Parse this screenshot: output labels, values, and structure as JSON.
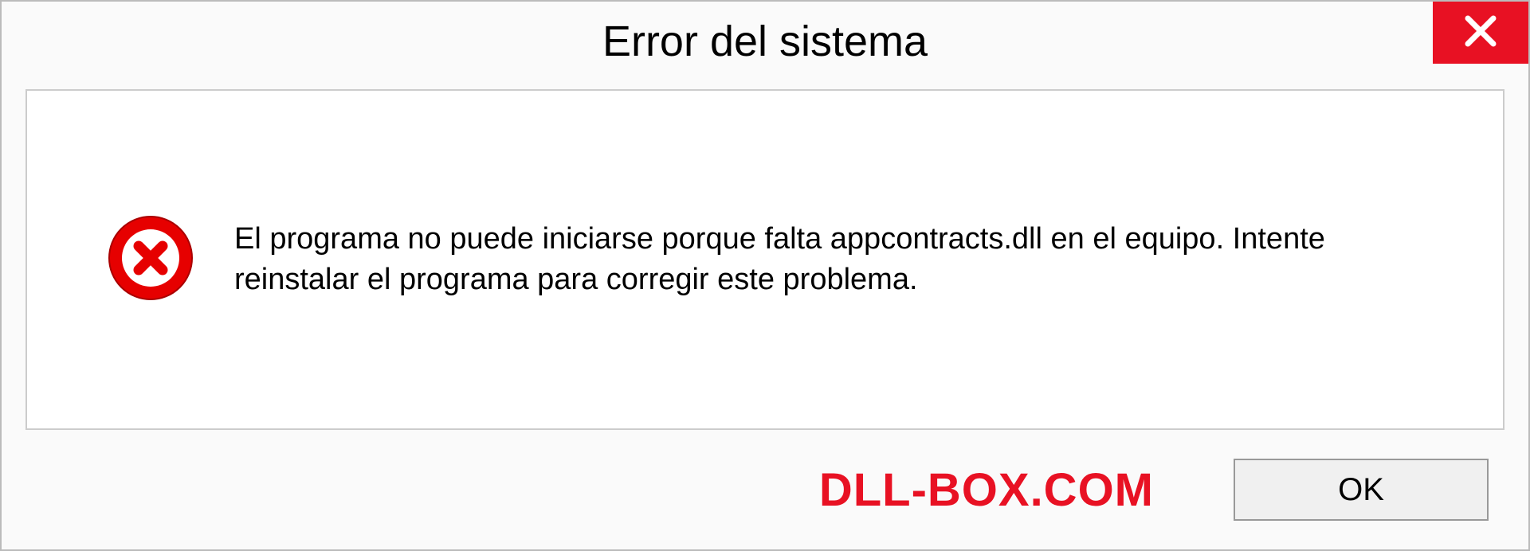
{
  "dialog": {
    "title": "Error del sistema",
    "message": "El programa no puede iniciarse porque falta appcontracts.dll en el equipo. Intente reinstalar el programa para corregir este problema.",
    "ok_label": "OK"
  },
  "watermark": "DLL-BOX.COM",
  "icons": {
    "close": "close-icon",
    "error": "error-icon"
  },
  "colors": {
    "close_bg": "#e81123",
    "error_bg": "#e60000",
    "watermark": "#e81123"
  }
}
